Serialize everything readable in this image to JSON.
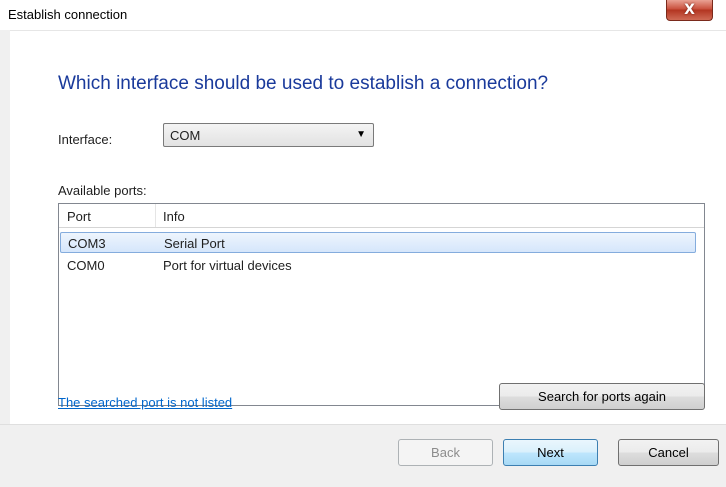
{
  "window": {
    "title": "Establish connection",
    "close_glyph": "X"
  },
  "main": {
    "heading": "Which interface should be used to establish a connection?",
    "interface_label": "Interface:",
    "interface_value": "COM",
    "ports_label": "Available ports:",
    "ports_table": {
      "columns": [
        "Port",
        "Info"
      ],
      "rows": [
        {
          "port": "COM3",
          "info": "Serial Port",
          "selected": true
        },
        {
          "port": "COM0",
          "info": "Port for virtual devices",
          "selected": false
        }
      ]
    },
    "not_listed_link": "The searched port is not listed",
    "search_button": "Search for ports again"
  },
  "footer": {
    "back_label": "Back",
    "next_label": "Next",
    "cancel_label": "Cancel"
  },
  "colors": {
    "heading": "#1a3a9b",
    "link": "#0066cc",
    "selection": "#d5e6fb"
  },
  "icons": {
    "dropdown": "chevron-down-icon",
    "close": "close-icon"
  }
}
